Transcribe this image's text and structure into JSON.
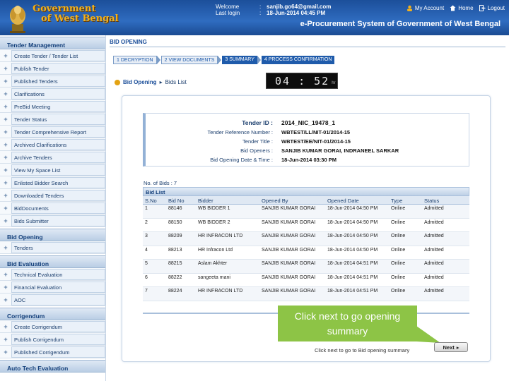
{
  "header": {
    "logo_line1": "Government",
    "logo_line2": "of West Bengal",
    "welcome_label": "Welcome",
    "welcome_value": "sanjib.go64@gmail.com",
    "last_login_label": "Last login",
    "last_login_value": "18-Jun-2014 04:45 PM",
    "my_account": "My Account",
    "home": "Home",
    "logout": "Logout",
    "system_title": "e-Procurement System of Government of West Bengal"
  },
  "sidebar": {
    "sections": [
      {
        "title": "Tender Management",
        "items": [
          "Create Tender / Tender List",
          "Publish Tender",
          "Published Tenders",
          "Clarifications",
          "PreBid Meeting",
          "Tender Status",
          "Tender Comprehensive Report",
          "Archived Clarifications",
          "Archive Tenders",
          "View My Space List",
          "Enlisted Bidder Search",
          "Downloaded Tenders",
          "BidDocuments",
          "Bids Submitter"
        ]
      },
      {
        "title": "Bid Opening",
        "items": [
          "Tenders"
        ]
      },
      {
        "title": "Bid Evaluation",
        "items": [
          "Technical Evaluation",
          "Financial Evaluation",
          "AOC"
        ]
      },
      {
        "title": "Corrigendum",
        "items": [
          "Create Corrigendum",
          "Publish Corrigendum",
          "Published Corrigendum"
        ]
      },
      {
        "title": "Auto Tech Evaluation",
        "items": []
      }
    ]
  },
  "main": {
    "heading": "BID OPENING",
    "steps": [
      "1 DECRYPTION",
      "2 VIEW DOCUMENTS",
      "3 SUMMARY",
      "4 PROCESS CONFIRMATION"
    ],
    "breadcrumb": {
      "bid_opening": "Bid Opening",
      "bids_list": "Bids List"
    },
    "timer": {
      "digits": "04 : 52",
      "unit": "hr"
    },
    "tender": {
      "id_label": "Tender ID :",
      "id_value": "2014_NIC_19478_1",
      "ref_label": "Tender Reference Number :",
      "ref_value": "WBTEST/LL/NIT-01/2014-15",
      "title_label": "Tender Title :",
      "title_value": "WBTEST/EE/NIT-01/2014-15",
      "openers_label": "Bid Openers :",
      "openers_value": "SANJIB KUMAR GORAI, INDRANEEL SARKAR",
      "date_label": "Bid Opening Date & Time :",
      "date_value": "18-Jun-2014 03:30 PM"
    },
    "no_of_bids": "No. of Bids : 7",
    "bid_list_title": "Bid List",
    "columns": [
      "S.No",
      "Bid No",
      "Bidder",
      "Opened By",
      "Opened Date",
      "Type",
      "Status"
    ],
    "rows": [
      [
        "1",
        "88146",
        "WB BIDDER 1",
        "SANJIB KUMAR GORAI",
        "18-Jun-2014 04:50 PM",
        "Online",
        "Admitted"
      ],
      [
        "2",
        "88150",
        "WB BIDDER 2",
        "SANJIB KUMAR GORAI",
        "18-Jun-2014 04:50 PM",
        "Online",
        "Admitted"
      ],
      [
        "3",
        "88209",
        "HR INFRACON LTD",
        "SANJIB KUMAR GORAI",
        "18-Jun-2014 04:50 PM",
        "Online",
        "Admitted"
      ],
      [
        "4",
        "88213",
        "HR Infracon Ltd",
        "SANJIB KUMAR GORAI",
        "18-Jun-2014 04:50 PM",
        "Online",
        "Admitted"
      ],
      [
        "5",
        "88215",
        "Aslam Akhter",
        "SANJIB KUMAR GORAI",
        "18-Jun-2014 04:51 PM",
        "Online",
        "Admitted"
      ],
      [
        "6",
        "88222",
        "sangeeta mani",
        "SANJIB KUMAR GORAI",
        "18-Jun-2014 04:51 PM",
        "Online",
        "Admitted"
      ],
      [
        "7",
        "88224",
        "HR INFRACON LTD",
        "SANJIB KUMAR GORAI",
        "18-Jun-2014 04:51 PM",
        "Online",
        "Admitted"
      ]
    ],
    "callout": "Click next to go opening summary",
    "next_hint": "Click next to go to Bid opening summary",
    "next_label": "Next"
  },
  "colors": {
    "header_blue": "#2f6cc0",
    "logo_gold": "#f2b11c",
    "callout_green": "#8dc446"
  }
}
